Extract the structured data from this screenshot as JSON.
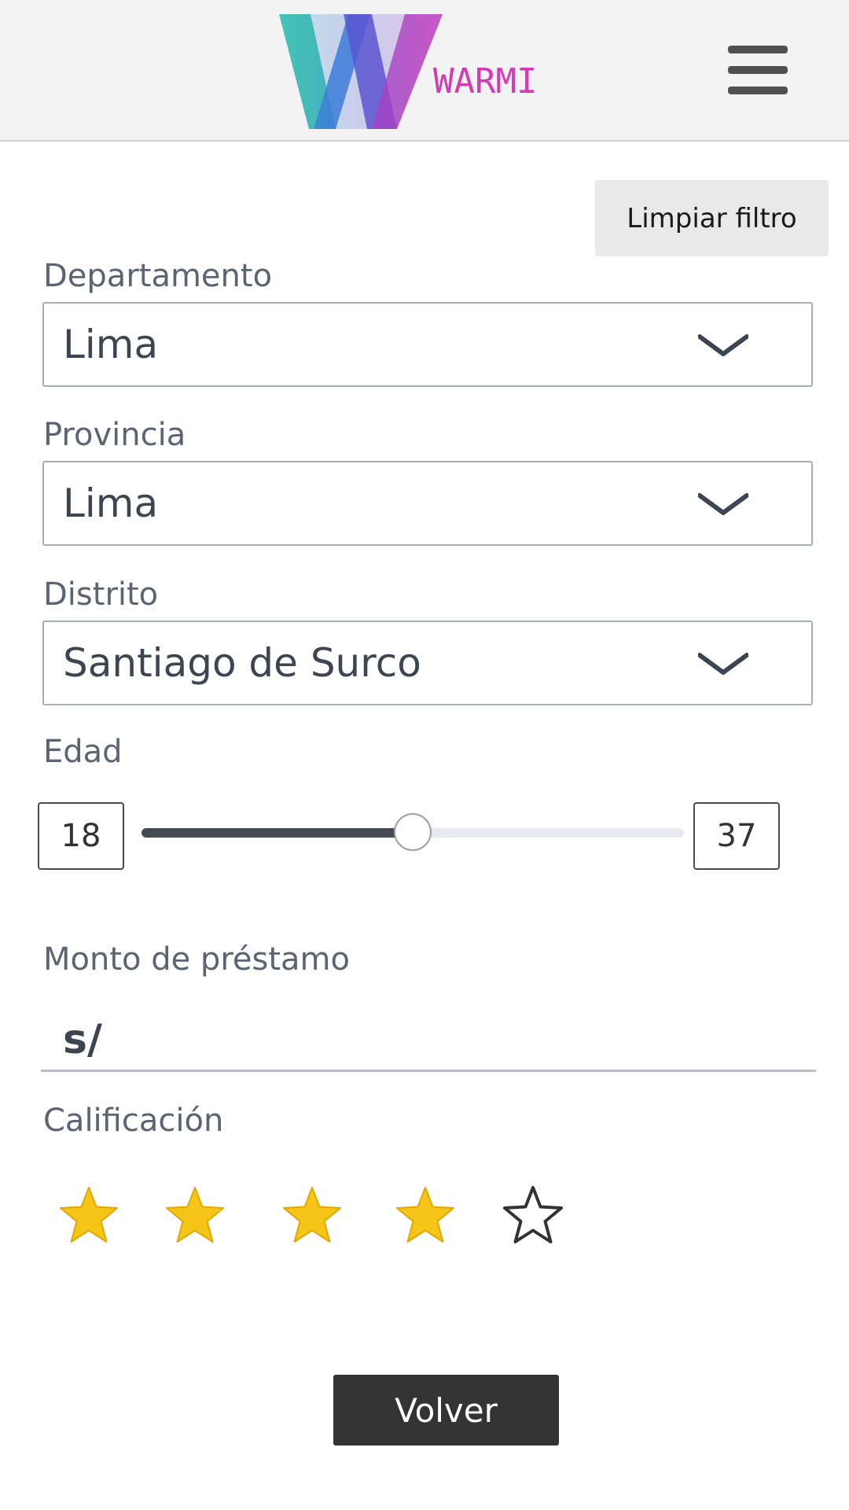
{
  "header": {
    "brand": "WARMI",
    "menu_icon": "hamburger-menu-icon"
  },
  "filters": {
    "clear_label": "Limpiar filtro",
    "departamento": {
      "label": "Departamento",
      "value": "Lima"
    },
    "provincia": {
      "label": "Provincia",
      "value": "Lima"
    },
    "distrito": {
      "label": "Distrito",
      "value": "Santiago de Surco"
    },
    "edad": {
      "label": "Edad",
      "min": "18",
      "max": "37",
      "slider_fraction": 0.5
    },
    "monto": {
      "label": "Monto de préstamo",
      "prefix": "s/"
    },
    "calificacion": {
      "label": "Calificación",
      "rating": 4,
      "max": 5
    }
  },
  "colors": {
    "star_filled": "#f5c518",
    "star_outline": "#333333",
    "accent_dark": "#333333"
  },
  "actions": {
    "back_label": "Volver"
  }
}
